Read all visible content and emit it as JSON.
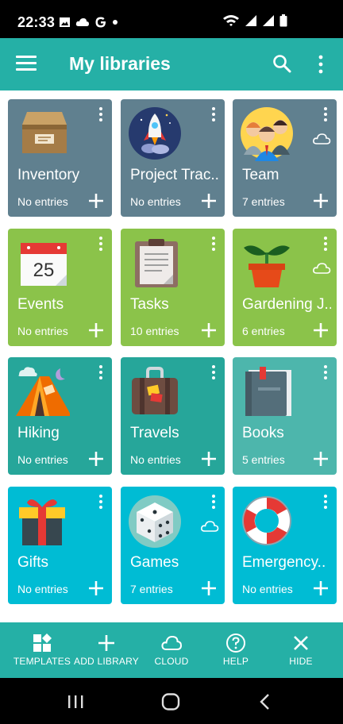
{
  "status": {
    "time": "22:33"
  },
  "app_bar": {
    "title": "My libraries"
  },
  "libraries": [
    {
      "name": "Inventory",
      "entries": "No entries",
      "icon": "box-icon",
      "color": "#60808f",
      "cloud": false
    },
    {
      "name": "Project Trac..",
      "entries": "No entries",
      "icon": "rocket-icon",
      "color": "#60808f",
      "cloud": false
    },
    {
      "name": "Team",
      "entries": "7 entries",
      "icon": "team-icon",
      "color": "#60808f",
      "cloud": true
    },
    {
      "name": "Events",
      "entries": "No entries",
      "icon": "calendar-icon",
      "color": "#8bc34a",
      "cloud": false
    },
    {
      "name": "Tasks",
      "entries": "10 entries",
      "icon": "clipboard-icon",
      "color": "#8bc34a",
      "cloud": false
    },
    {
      "name": "Gardening J..",
      "entries": "6 entries",
      "icon": "plant-icon",
      "color": "#8bc34a",
      "cloud": true
    },
    {
      "name": "Hiking",
      "entries": "No entries",
      "icon": "tent-icon",
      "color": "#26a69a",
      "cloud": false
    },
    {
      "name": "Travels",
      "entries": "No entries",
      "icon": "suitcase-icon",
      "color": "#26a69a",
      "cloud": false
    },
    {
      "name": "Books",
      "entries": "5 entries",
      "icon": "book-icon",
      "color": "#4db6ac",
      "cloud": false
    },
    {
      "name": "Gifts",
      "entries": "No entries",
      "icon": "gift-icon",
      "color": "#00bcd4",
      "cloud": false
    },
    {
      "name": "Games",
      "entries": "7 entries",
      "icon": "dice-icon",
      "color": "#00bcd4",
      "cloud": true
    },
    {
      "name": "Emergency..",
      "entries": "No entries",
      "icon": "lifebuoy-icon",
      "color": "#00bcd4",
      "cloud": false
    }
  ],
  "bottom_bar": [
    {
      "label": "TEMPLATES",
      "icon": "templates-icon"
    },
    {
      "label": "ADD LIBRARY",
      "icon": "plus-icon"
    },
    {
      "label": "CLOUD",
      "icon": "cloud-icon"
    },
    {
      "label": "HELP",
      "icon": "help-icon"
    },
    {
      "label": "HIDE",
      "icon": "close-icon"
    }
  ],
  "colors": {
    "primary": "#25b0a6",
    "slate": "#60808f",
    "green": "#8bc34a",
    "teal": "#26a69a",
    "cyan": "#00bcd4"
  }
}
